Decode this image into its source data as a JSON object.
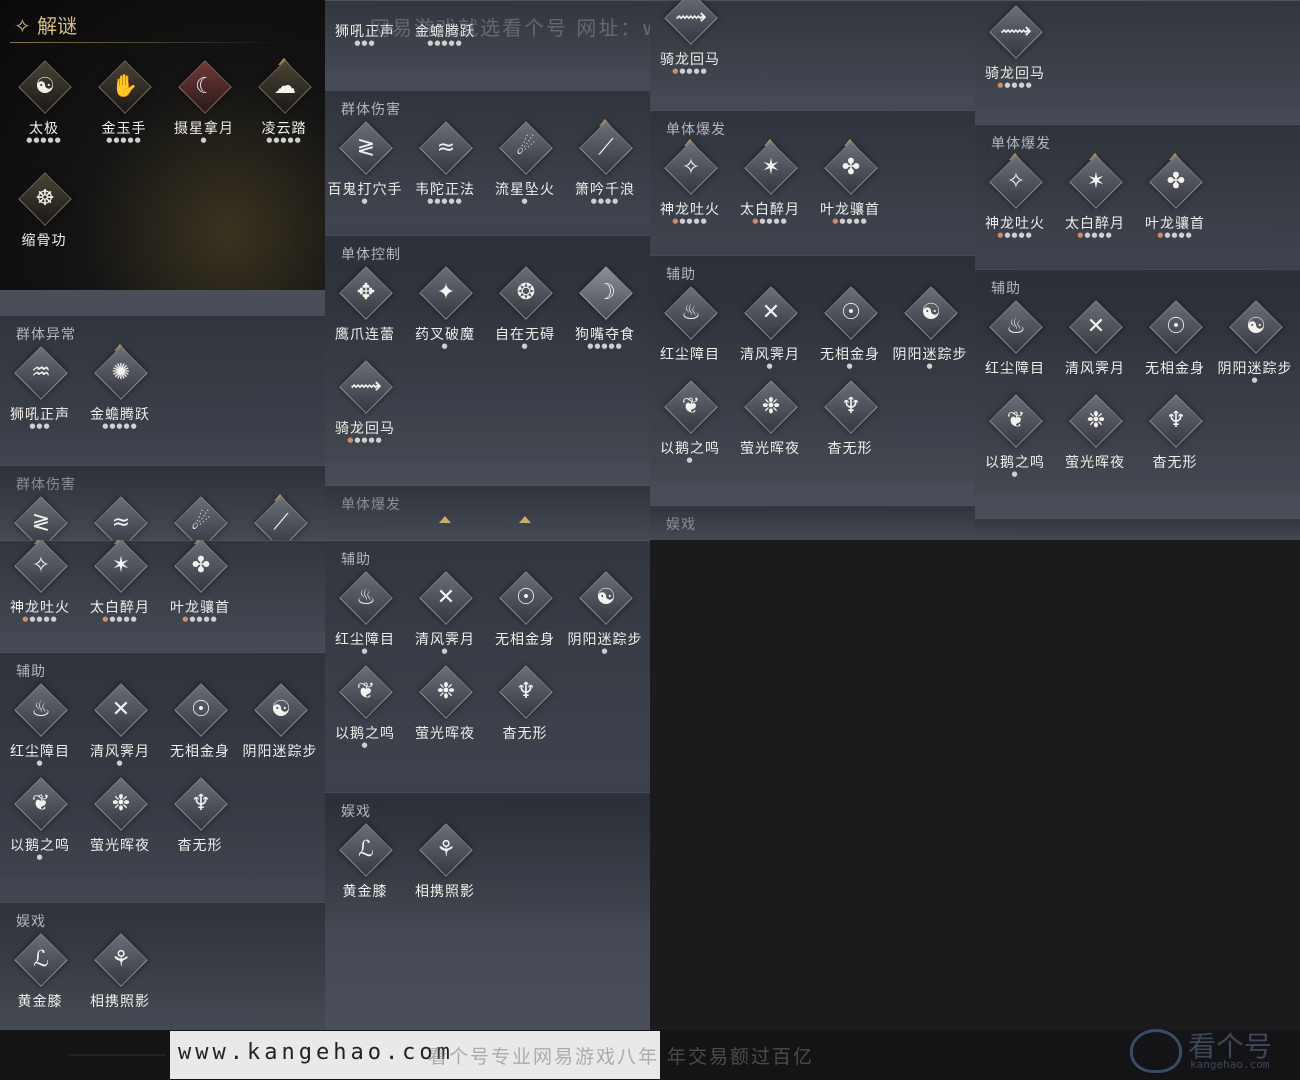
{
  "title": "解谜",
  "watermark_top": "网易游戏就选看个号  网址：www.kangehao.com",
  "footer": {
    "url": "www.kangehao.com",
    "slogan": "看个号专业网易游戏八年  年交易额过百亿",
    "logo": "看个号",
    "logo_sub": "kangehao.com"
  },
  "section_titles": {
    "group_abnormal": "群体异常",
    "group_damage": "群体伤害",
    "single_control": "单体控制",
    "single_burst": "单体爆发",
    "support": "辅助",
    "entertainment": "娱戏"
  },
  "skills": {
    "taiji": "太极",
    "jinyu": "金玉手",
    "shexing": "摄星拿月",
    "lingyun": "凌云踏",
    "suogu": "缩骨功",
    "shihou": "狮吼正声",
    "jinchan": "金蟾腾跃",
    "baigui": "百鬼打穴手",
    "weituo": "韦陀正法",
    "liuxing": "流星坠火",
    "xiaoyin": "箫吟千浪",
    "yingzhua": "鹰爪连蕾",
    "yaocha": "药叉破魔",
    "zizai": "自在无碍",
    "goushi": "狗嘴夺食",
    "qilong": "骑龙回马",
    "shenlong": "神龙吐火",
    "taibai": "太白醉月",
    "yelong": "叶龙骧首",
    "hongchen": "红尘障目",
    "qingfeng": "清风霁月",
    "wuxiang": "无相金身",
    "yinyang": "阴阳迷踪步",
    "yihe": "以鹅之鸣",
    "yingguang": "萤光晖夜",
    "yaowu": "杳无形",
    "huangjin": "黄金膝",
    "xiangxie": "相携照影"
  },
  "icons": {
    "taiji": "martial-circle-icon",
    "jinyu": "jade-hand-icon",
    "shexing": "moon-grab-icon",
    "lingyun": "cloud-step-icon",
    "suogu": "bone-shrink-icon"
  },
  "colors": {
    "gold_title": "#d6bd8a",
    "pip_highlight": "#d38a6a",
    "panel_bg": "#40454f"
  }
}
